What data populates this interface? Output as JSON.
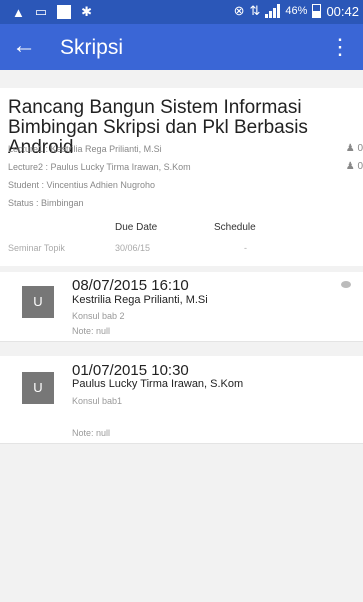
{
  "status_bar": {
    "battery_percent": "46%",
    "time": "00:42"
  },
  "app_bar": {
    "back_icon": "arrow-left-icon",
    "title": "Skripsi",
    "menu_icon": "more-vert-icon"
  },
  "thesis": {
    "title": "Rancang Bangun Sistem Informasi Bimbingan Skripsi dan Pkl Berbasis Android",
    "lecturer1_label": "Lecture1 :",
    "lecturer1_name": "Kestrilia Rega Prilianti, M.Si",
    "lecturer2_label": "Lecture2 :",
    "lecturer2_name": "Paulus Lucky Tirma Irawan, S.Kom",
    "student_label": "Student  :",
    "student_name": "Vincentius Adhien Nugroho",
    "status_label": "Status   :",
    "status_value": "Bimbingan",
    "role_icon_text_1": "0",
    "role_icon_text_2": "0",
    "col_due": "Due Date",
    "col_schedule": "Schedule",
    "seminar_label": "Seminar Topik",
    "seminar_due": "30/06/15",
    "seminar_schedule": "-"
  },
  "consultations": [
    {
      "avatar": "U",
      "datetime": "08/07/2015  16:10",
      "lecturer": "Kestrilia Rega Prilianti, M.Si",
      "description": "Konsul bab 2",
      "note": "Note: null"
    },
    {
      "avatar": "U",
      "datetime": "01/07/2015  10:30",
      "lecturer": "Paulus Lucky Tirma Irawan, S.Kom",
      "description": "Konsul bab1",
      "note": "Note: null"
    }
  ]
}
